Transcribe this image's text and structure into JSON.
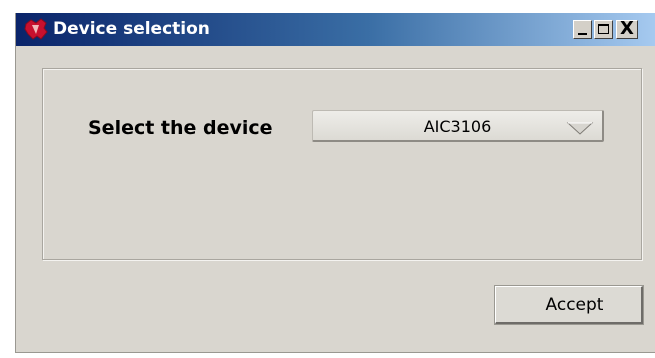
{
  "window": {
    "title": "Device selection",
    "title_bar_colors": [
      "#0a246a",
      "#3a6ea5",
      "#a6caf0"
    ],
    "controls": {
      "minimize_icon": "minimize-icon",
      "maximize_icon": "maximize-icon",
      "close_label": "X"
    }
  },
  "form": {
    "select_label": "Select the device",
    "device_dropdown": {
      "selected_value": "AIC3106",
      "arrow_icon": "chevron-down-icon"
    },
    "accept_label": "Accept"
  }
}
